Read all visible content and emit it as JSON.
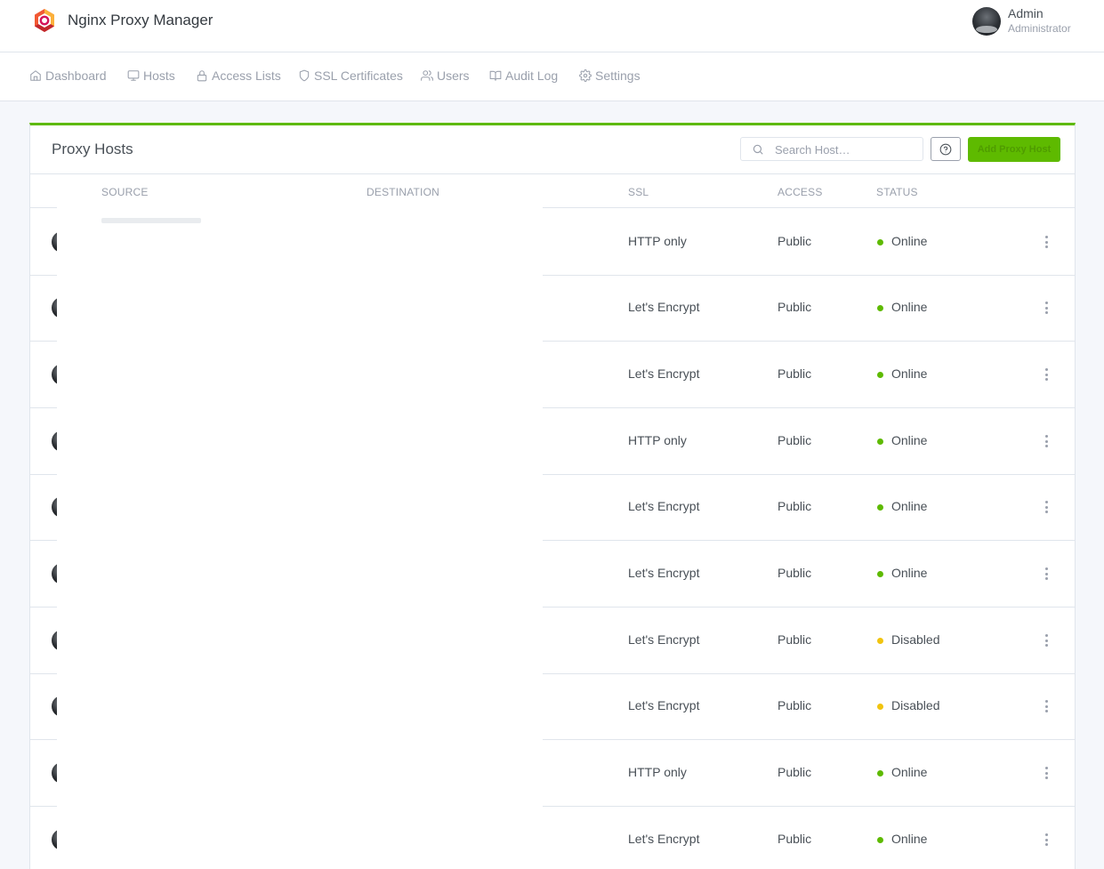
{
  "app": {
    "title": "Nginx Proxy Manager"
  },
  "user": {
    "name": "Admin",
    "role": "Administrator"
  },
  "nav": [
    {
      "label": "Dashboard",
      "icon": "home-icon"
    },
    {
      "label": "Hosts",
      "icon": "monitor-icon"
    },
    {
      "label": "Access Lists",
      "icon": "lock-icon"
    },
    {
      "label": "SSL Certificates",
      "icon": "shield-icon"
    },
    {
      "label": "Users",
      "icon": "users-icon"
    },
    {
      "label": "Audit Log",
      "icon": "book-icon"
    },
    {
      "label": "Settings",
      "icon": "gear-icon"
    }
  ],
  "card": {
    "title": "Proxy Hosts",
    "search_placeholder": "Search Host…",
    "add_label": "Add Proxy Host",
    "accent_color": "#5eba00"
  },
  "columns": {
    "source": "SOURCE",
    "destination": "DESTINATION",
    "ssl": "SSL",
    "access": "ACCESS",
    "status": "STATUS"
  },
  "status_colors": {
    "Online": "#5eba00",
    "Disabled": "#f1c40f"
  },
  "rows": [
    {
      "ssl": "HTTP only",
      "access": "Public",
      "status": "Online"
    },
    {
      "ssl": "Let's Encrypt",
      "access": "Public",
      "status": "Online"
    },
    {
      "ssl": "Let's Encrypt",
      "access": "Public",
      "status": "Online"
    },
    {
      "ssl": "HTTP only",
      "access": "Public",
      "status": "Online"
    },
    {
      "ssl": "Let's Encrypt",
      "access": "Public",
      "status": "Online"
    },
    {
      "ssl": "Let's Encrypt",
      "access": "Public",
      "status": "Online"
    },
    {
      "ssl": "Let's Encrypt",
      "access": "Public",
      "status": "Disabled"
    },
    {
      "ssl": "Let's Encrypt",
      "access": "Public",
      "status": "Disabled"
    },
    {
      "ssl": "HTTP only",
      "access": "Public",
      "status": "Online"
    },
    {
      "ssl": "Let's Encrypt",
      "access": "Public",
      "status": "Online"
    }
  ]
}
